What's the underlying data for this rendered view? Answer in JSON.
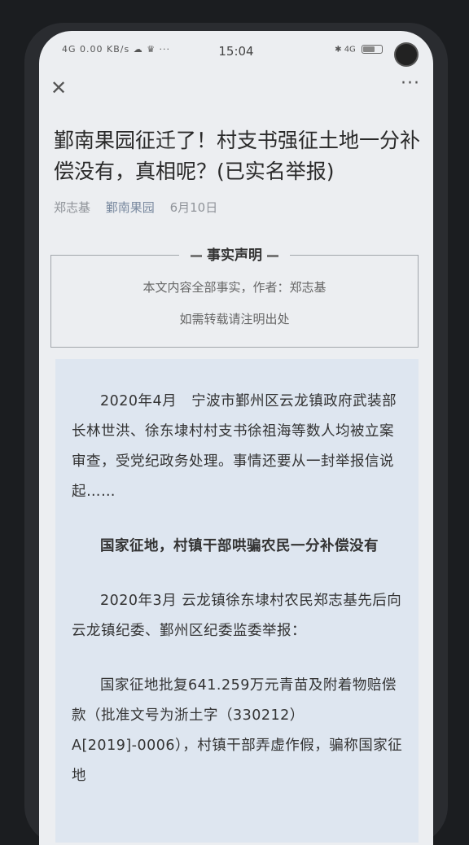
{
  "status_bar": {
    "left_icons": "4G 0.00 KB/s ☁ ♛ ···",
    "time": "15:04",
    "right_icons": "✱ 4G"
  },
  "nav": {
    "close_glyph": "✕",
    "more_glyph": "···"
  },
  "article": {
    "title": "鄞南果园征迁了！村支书强征土地一分补偿没有，真相呢？(已实名举报)",
    "author": "郑志基",
    "source": "鄞南果园",
    "date": "6月10日"
  },
  "notice": {
    "heading": "事实声明",
    "line1": "本文内容全部事实，作者：郑志基",
    "line2": "如需转载请注明出处"
  },
  "body": {
    "p1": "2020年4月　宁波市鄞州区云龙镇政府武装部长林世洪、徐东埭村村支书徐祖海等数人均被立案审查，受党纪政务处理。事情还要从一封举报信说起……",
    "p2": "国家征地，村镇干部哄骗农民一分补偿没有",
    "p3": "2020年3月 云龙镇徐东埭村农民郑志基先后向云龙镇纪委、鄞州区纪委监委举报：",
    "p4": "国家征地批复641.259万元青苗及附着物赔偿款（批准文号为浙土字（330212）A[2019]-0006），村镇干部弄虚作假，骗称国家征地"
  }
}
